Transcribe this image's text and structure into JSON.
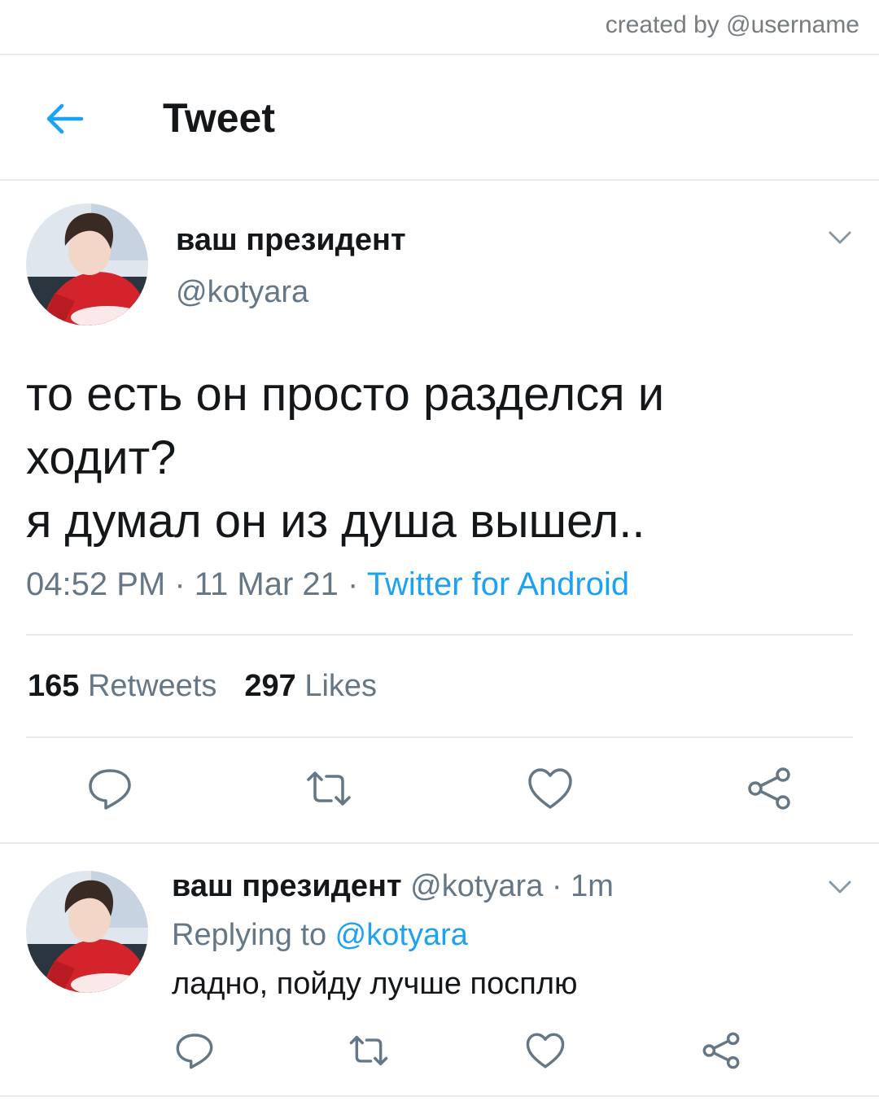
{
  "watermark": "created by @username",
  "header": {
    "title": "Tweet",
    "back_icon": "arrow-left-icon"
  },
  "tweet": {
    "display_name": "ваш президент",
    "handle": "@kotyara",
    "lines": [
      "то есть он просто разделся и",
      "ходит?",
      "я думал он из душа вышел.."
    ],
    "time": "04:52 PM",
    "sep1": " · ",
    "date": "11 Mar 21",
    "sep2": " · ",
    "source": "Twitter for Android",
    "retweets_count": "165",
    "retweets_label": "Retweets",
    "likes_count": "297",
    "likes_label": "Likes",
    "actions": [
      "reply-icon",
      "retweet-icon",
      "like-icon",
      "share-icon"
    ]
  },
  "reply": {
    "display_name": "ваш президент",
    "handle": "@kotyara",
    "sep": " · ",
    "age": "1m",
    "replying_prefix": "Replying to ",
    "replying_handle": "@kotyara",
    "text": "ладно, пойду лучше посплю",
    "actions": [
      "reply-icon",
      "retweet-icon",
      "like-icon",
      "share-icon"
    ]
  },
  "colors": {
    "accent": "#1da1f2",
    "muted": "#657786",
    "text": "#14171a",
    "divider": "#e6ecf0"
  }
}
